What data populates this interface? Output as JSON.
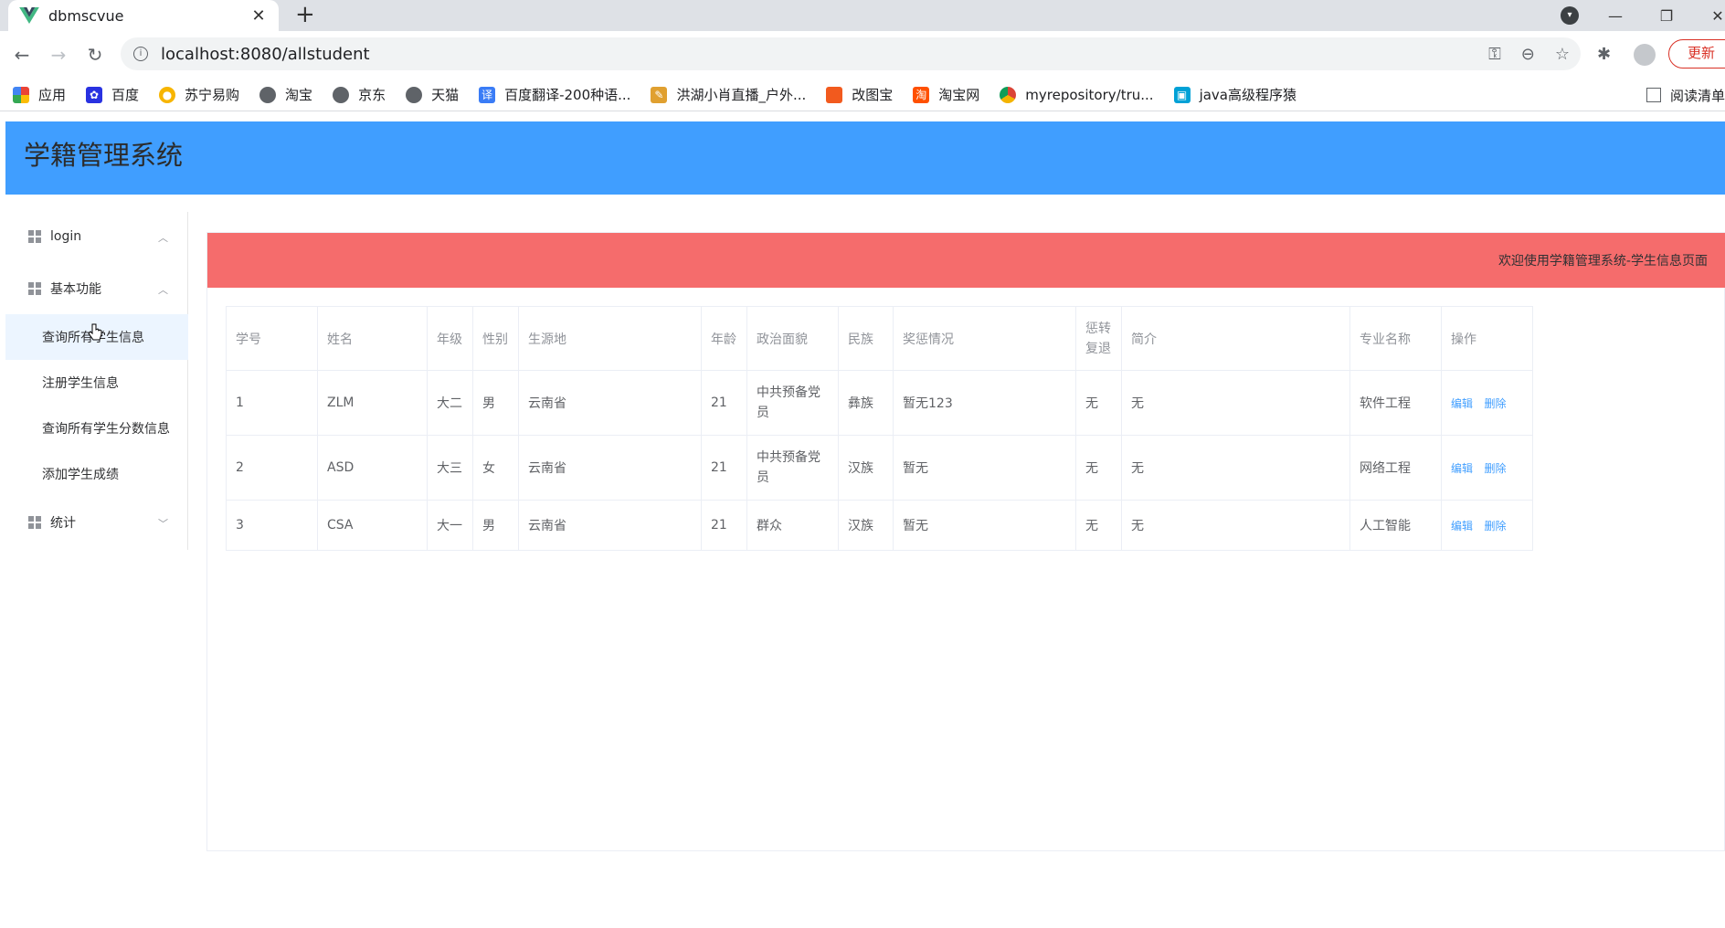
{
  "browser": {
    "tab_title": "dbmscvue",
    "url": "localhost:8080/allstudent",
    "update_label": "更新",
    "reader_label": "阅读清单",
    "bookmarks": [
      {
        "label": "应用",
        "icon": "apps-grid-icon",
        "color": "#4285f4"
      },
      {
        "label": "百度",
        "icon": "baidu-paw-icon",
        "color": "#2932e1"
      },
      {
        "label": "苏宁易购",
        "icon": "suning-icon",
        "color": "#f7b500"
      },
      {
        "label": "淘宝",
        "icon": "globe-icon",
        "color": "#5f6368"
      },
      {
        "label": "京东",
        "icon": "globe-icon",
        "color": "#5f6368"
      },
      {
        "label": "天猫",
        "icon": "globe-icon",
        "color": "#5f6368"
      },
      {
        "label": "百度翻译-200种语...",
        "icon": "translate-icon",
        "color": "#3a7cf6"
      },
      {
        "label": "洪湖小肖直播_户外...",
        "icon": "feather-icon",
        "color": "#e0a030"
      },
      {
        "label": "改图宝",
        "icon": "gaitubao-icon",
        "color": "#f25a1e"
      },
      {
        "label": "淘宝网",
        "icon": "taobao-icon",
        "color": "#ff5000"
      },
      {
        "label": "myrepository/tru...",
        "icon": "chrome-icon",
        "color": "#db4437"
      },
      {
        "label": "java高级程序猿",
        "icon": "bilibili-icon",
        "color": "#00a1d6"
      }
    ]
  },
  "app": {
    "title": "学籍管理系统",
    "welcome": "欢迎使用学籍管理系统-学生信息页面"
  },
  "sidebar": {
    "groups": [
      {
        "label": "login"
      },
      {
        "label": "基本功能"
      },
      {
        "label": "统计"
      }
    ],
    "items": [
      {
        "label": "查询所有学生信息"
      },
      {
        "label": "注册学生信息"
      },
      {
        "label": "查询所有学生分数信息"
      },
      {
        "label": "添加学生成绩"
      }
    ]
  },
  "table": {
    "headers": {
      "id": "学号",
      "name": "姓名",
      "grade": "年级",
      "gender": "性别",
      "origin": "生源地",
      "age": "年龄",
      "politics": "政治面貌",
      "ethnic": "民族",
      "award": "奖惩情况",
      "transfer_1": "惩转",
      "transfer_2": "复退",
      "intro": "简介",
      "major": "专业名称",
      "ops": "操作"
    },
    "rows": [
      {
        "id": "1",
        "name": "ZLM",
        "grade": "大二",
        "gender": "男",
        "origin": "云南省",
        "age": "21",
        "politics_1": "中共预备党",
        "politics_2": "员",
        "ethnic": "彝族",
        "award": "暂无123",
        "transfer": "无",
        "intro": "无",
        "major": "软件工程",
        "edit": "编辑",
        "delete": "删除"
      },
      {
        "id": "2",
        "name": "ASD",
        "grade": "大三",
        "gender": "女",
        "origin": "云南省",
        "age": "21",
        "politics_1": "中共预备党",
        "politics_2": "员",
        "ethnic": "汉族",
        "award": "暂无",
        "transfer": "无",
        "intro": "无",
        "major": "网络工程",
        "edit": "编辑",
        "delete": "删除"
      },
      {
        "id": "3",
        "name": "CSA",
        "grade": "大一",
        "gender": "男",
        "origin": "云南省",
        "age": "21",
        "politics_1": "群众",
        "politics_2": "",
        "ethnic": "汉族",
        "award": "暂无",
        "transfer": "无",
        "intro": "无",
        "major": "人工智能",
        "edit": "编辑",
        "delete": "删除"
      }
    ]
  }
}
